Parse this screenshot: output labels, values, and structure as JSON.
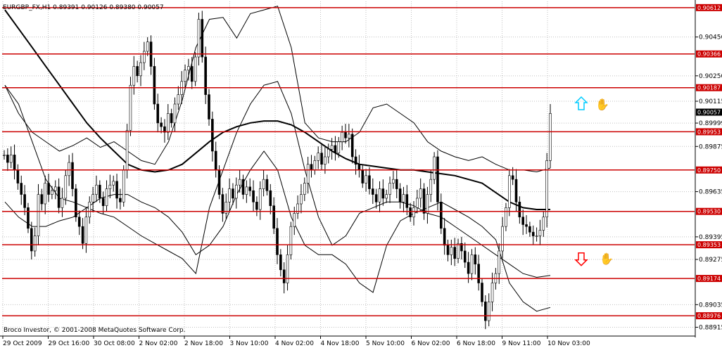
{
  "header": {
    "title": "EURGBP_FX,H1  0.89391 0.90126 0.89380 0.90057"
  },
  "footer": {
    "copyright": "Broco Investor, © 2001-2008 MetaQuotes Software Corp."
  },
  "colors": {
    "background": "#ffffff",
    "grid": "#c0c0c0",
    "level_line": "#cc0000",
    "price_line": "#000000",
    "up_arrow": "#00ccff",
    "down_arrow": "#ff0000",
    "tag_fill_level": "#cc0000",
    "tag_fill_current": "#000000"
  },
  "chart_data": {
    "type": "candlestick",
    "symbol": "EURGBP_FX",
    "timeframe": "H1",
    "ohlc_current": {
      "open": 0.89391,
      "high": 0.90126,
      "low": 0.8938,
      "close": 0.90057
    },
    "ylim": [
      0.88872,
      0.90645
    ],
    "grid": true,
    "y_ticks": [
      "0.90456",
      "0.90250",
      "0.90115",
      "0.89999",
      "0.89875",
      "0.89635",
      "0.89395",
      "0.89275",
      "0.89035",
      "0.88915"
    ],
    "x_ticks": [
      "29 Oct 2009",
      "29 Oct 16:00",
      "30 Oct 08:00",
      "2 Nov 02:00",
      "2 Nov 18:00",
      "3 Nov 10:00",
      "4 Nov 02:00",
      "4 Nov 18:00",
      "5 Nov 10:00",
      "6 Nov 02:00",
      "6 Nov 18:00",
      "9 Nov 11:00",
      "10 Nov 03:00"
    ],
    "levels": [
      {
        "label": "0.90612",
        "value": 0.90612
      },
      {
        "label": "0.90366",
        "value": 0.90366
      },
      {
        "label": "0.90187",
        "value": 0.90187
      },
      {
        "label": "0.89953",
        "value": 0.89953
      },
      {
        "label": "0.89750",
        "value": 0.8975
      },
      {
        "label": "0.89530",
        "value": 0.8953
      },
      {
        "label": "0.89353",
        "value": 0.89353
      },
      {
        "label": "0.89174",
        "value": 0.89174
      },
      {
        "label": "0.88976",
        "value": 0.88976
      }
    ],
    "current_price_tag": "0.90057",
    "close_path": [
      0.8983,
      0.8979,
      0.8983,
      0.8975,
      0.8968,
      0.8962,
      0.8955,
      0.8944,
      0.8932,
      0.894,
      0.8962,
      0.8957,
      0.8968,
      0.8962,
      0.8964,
      0.8966,
      0.8955,
      0.896,
      0.8972,
      0.8979,
      0.8965,
      0.895,
      0.8945,
      0.8936,
      0.895,
      0.8958,
      0.8962,
      0.8967,
      0.896,
      0.8956,
      0.8965,
      0.8967,
      0.8969,
      0.896,
      0.8958,
      0.8975,
      0.8996,
      0.902,
      0.903,
      0.9025,
      0.9032,
      0.9038,
      0.9043,
      0.903,
      0.901,
      0.9,
      0.8998,
      0.8995,
      0.9005,
      0.9,
      0.901,
      0.9015,
      0.9022,
      0.9028,
      0.903,
      0.9022,
      0.9035,
      0.9055,
      0.9035,
      0.9015,
      0.9002,
      0.8985,
      0.8975,
      0.8962,
      0.8952,
      0.8958,
      0.8965,
      0.896,
      0.8967,
      0.897,
      0.8962,
      0.8966,
      0.8964,
      0.8958,
      0.8954,
      0.8965,
      0.897,
      0.8964,
      0.8956,
      0.8944,
      0.893,
      0.8922,
      0.8915,
      0.893,
      0.8945,
      0.8952,
      0.8957,
      0.8962,
      0.8968,
      0.8978,
      0.8975,
      0.898,
      0.8984,
      0.8978,
      0.8982,
      0.8986,
      0.8988,
      0.8984,
      0.899,
      0.8995,
      0.8992,
      0.8994,
      0.8982,
      0.8978,
      0.8975,
      0.8968,
      0.8972,
      0.8965,
      0.8962,
      0.8958,
      0.8965,
      0.896,
      0.8962,
      0.8968,
      0.897,
      0.8965,
      0.8958,
      0.8962,
      0.8955,
      0.895,
      0.8955,
      0.896,
      0.8965,
      0.8952,
      0.8962,
      0.897,
      0.8982,
      0.8958,
      0.8944,
      0.8935,
      0.893,
      0.8934,
      0.8928,
      0.8936,
      0.8932,
      0.8926,
      0.892,
      0.893,
      0.8925,
      0.8915,
      0.8905,
      0.8895,
      0.8905,
      0.8915,
      0.892,
      0.8932,
      0.8945,
      0.8955,
      0.8972,
      0.897,
      0.8958,
      0.895,
      0.8946,
      0.8945,
      0.8942,
      0.894,
      0.894,
      0.8943,
      0.895,
      0.898,
      0.9005
    ],
    "overlays": [
      {
        "kind": "moving-average",
        "values": [
          0.906,
          0.905,
          0.904,
          0.903,
          0.902,
          0.901,
          0.9,
          0.8992,
          0.8985,
          0.8978,
          0.8975,
          0.8974,
          0.8975,
          0.8978,
          0.8984,
          0.899,
          0.8995,
          0.8998,
          0.9,
          0.9001,
          0.9001,
          0.8999,
          0.8995,
          0.899,
          0.8985,
          0.8981,
          0.8978,
          0.8977,
          0.8976,
          0.8975,
          0.8975,
          0.8974,
          0.8973,
          0.8972,
          0.897,
          0.8968,
          0.8963,
          0.8958,
          0.8955,
          0.8954,
          0.8954
        ]
      },
      {
        "kind": "band-upper",
        "values": [
          0.902,
          0.9005,
          0.8995,
          0.899,
          0.8985,
          0.8988,
          0.8992,
          0.8987,
          0.899,
          0.8985,
          0.898,
          0.8978,
          0.899,
          0.9012,
          0.904,
          0.9055,
          0.9056,
          0.9045,
          0.9058,
          0.906,
          0.9062,
          0.904,
          0.9,
          0.8992,
          0.899,
          0.899,
          0.8995,
          0.9008,
          0.901,
          0.9005,
          0.9,
          0.899,
          0.8985,
          0.8982,
          0.898,
          0.8982,
          0.8978,
          0.8975,
          0.8975,
          0.8974,
          0.8976
        ]
      },
      {
        "kind": "band-lower",
        "values": [
          0.8958,
          0.895,
          0.8945,
          0.8945,
          0.8948,
          0.895,
          0.8955,
          0.896,
          0.8962,
          0.8962,
          0.8958,
          0.8955,
          0.895,
          0.8942,
          0.893,
          0.8935,
          0.8945,
          0.8962,
          0.8975,
          0.8985,
          0.8975,
          0.895,
          0.8935,
          0.893,
          0.893,
          0.8925,
          0.8915,
          0.891,
          0.8935,
          0.8948,
          0.8952,
          0.8955,
          0.8958,
          0.8954,
          0.895,
          0.8945,
          0.8938,
          0.8915,
          0.8905,
          0.89,
          0.8902
        ]
      },
      {
        "kind": "band-wide-lower",
        "values": [
          0.902,
          0.901,
          0.899,
          0.897,
          0.896,
          0.8958,
          0.8955,
          0.8952,
          0.895,
          0.8945,
          0.894,
          0.8936,
          0.8932,
          0.8928,
          0.892,
          0.8955,
          0.8975,
          0.8995,
          0.901,
          0.902,
          0.9022,
          0.9005,
          0.8975,
          0.895,
          0.8935,
          0.894,
          0.8952,
          0.8955,
          0.8958,
          0.8958,
          0.8956,
          0.8952,
          0.895,
          0.8945,
          0.894,
          0.8935,
          0.893,
          0.8925,
          0.892,
          0.8918,
          0.8919
        ]
      }
    ],
    "signals": [
      {
        "kind": "up-arrow",
        "near_level": "0.90187"
      },
      {
        "kind": "down-arrow",
        "near_level": "0.89353"
      }
    ]
  }
}
